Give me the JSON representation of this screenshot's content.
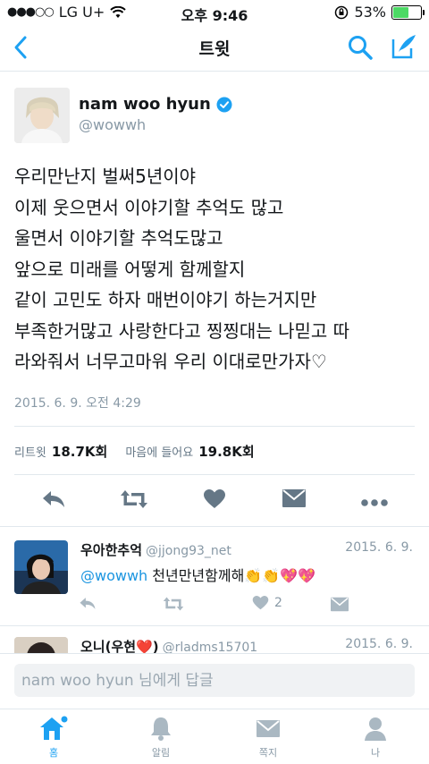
{
  "status_bar": {
    "carrier": "LG U+",
    "time": "오후 9:46",
    "battery": "53%",
    "battery_level": 0.53
  },
  "nav": {
    "title": "트윗",
    "accent": "#1da1f2"
  },
  "tweet": {
    "author_name": "nam woo hyun",
    "handle": "@wowwh",
    "lines": [
      "우리만난지 벌써5년이야",
      "이제 웃으면서 이야기할 추억도 많고",
      "울면서 이야기할 추억도많고",
      "앞으로 미래를 어떻게 함께할지",
      "같이 고민도 하자 매번이야기 하는거지만",
      "부족한거많고 사랑한다고 찡찡대는 나믿고 따",
      "라와줘서 너무고마워 우리 이대로만가자♡"
    ],
    "timestamp": "2015. 6. 9. 오전 4:29",
    "retweets_label": "리트윗",
    "retweets_count": "18.7K회",
    "likes_label": "마음에 들어요",
    "likes_count": "19.8K회"
  },
  "replies": [
    {
      "name": "우아한추억",
      "handle": "@jjong93_net",
      "date": "2015. 6. 9.",
      "mention": "@wowwh",
      "text": " 천년만년함께해👏👏💖💖",
      "like_count": "2"
    },
    {
      "name": "오니(우현❤️)",
      "handle": "@rladms15701",
      "date": "2015. 6. 9."
    }
  ],
  "reply_box": {
    "placeholder": "nam woo hyun 님에게 답글"
  },
  "tabs": [
    {
      "label": "홈"
    },
    {
      "label": "알림"
    },
    {
      "label": "쪽지"
    },
    {
      "label": "나"
    }
  ]
}
